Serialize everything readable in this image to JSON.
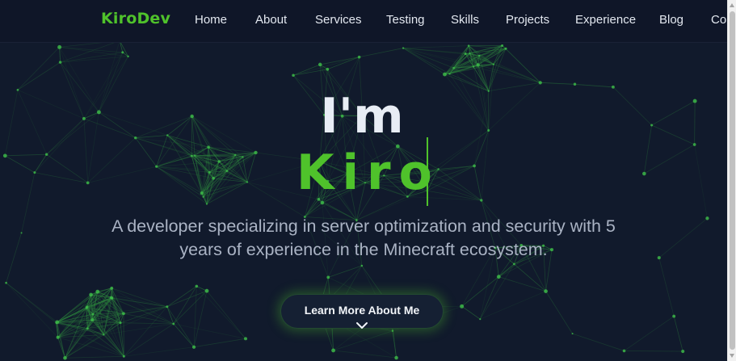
{
  "nav": {
    "logo": "KiroDev",
    "links": [
      "Home",
      "About",
      "Services",
      "Testing",
      "Skills",
      "Projects",
      "Experience",
      "Blog",
      "Co"
    ]
  },
  "hero": {
    "line1": "I'm",
    "line2": "Kiro",
    "tagline": "A developer specializing in server optimization and security with 5 years of experience in the Minecraft ecosystem.",
    "cta_label": "Learn More About Me",
    "cta_icon": "chevron-down-icon"
  },
  "colors": {
    "background": "#111a2c",
    "accent": "#4fc22b",
    "heading": "#e8edf5",
    "text": "#aab3c4"
  }
}
